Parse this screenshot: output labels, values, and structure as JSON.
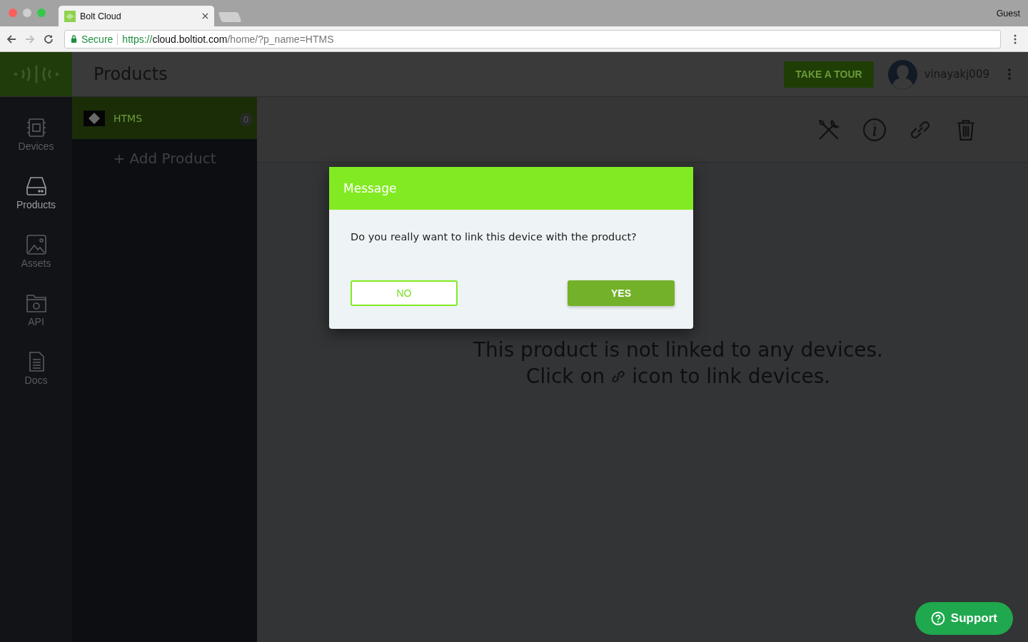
{
  "browser": {
    "tab_title": "Bolt Cloud",
    "profile": "Guest",
    "secure_label": "Secure",
    "url_scheme": "https://",
    "url_host": "cloud.boltiot.com",
    "url_path": "/home/?p_name=HTMS"
  },
  "header": {
    "title": "Products",
    "tour_button": "TAKE A TOUR",
    "username": "vinayakj009"
  },
  "sidebar": {
    "items": [
      {
        "label": "Devices",
        "selected": false
      },
      {
        "label": "Products",
        "selected": true
      },
      {
        "label": "Assets",
        "selected": false
      },
      {
        "label": "API",
        "selected": false
      },
      {
        "label": "Docs",
        "selected": false
      }
    ]
  },
  "products": {
    "items": [
      {
        "name": "HTMS",
        "count": "0",
        "selected": true
      }
    ],
    "add_label": "+ Add Product"
  },
  "empty_message": {
    "line_1": "This product is not linked to any devices.",
    "line_2_before": "Click on",
    "line_2_after": "icon to link devices."
  },
  "dialog": {
    "title": "Message",
    "text": "Do you really want to link this device with the product?",
    "buttons": [
      {
        "label": "NO",
        "kind": "outline"
      },
      {
        "label": "YES",
        "kind": "filled"
      }
    ]
  },
  "support_button": "Support"
}
